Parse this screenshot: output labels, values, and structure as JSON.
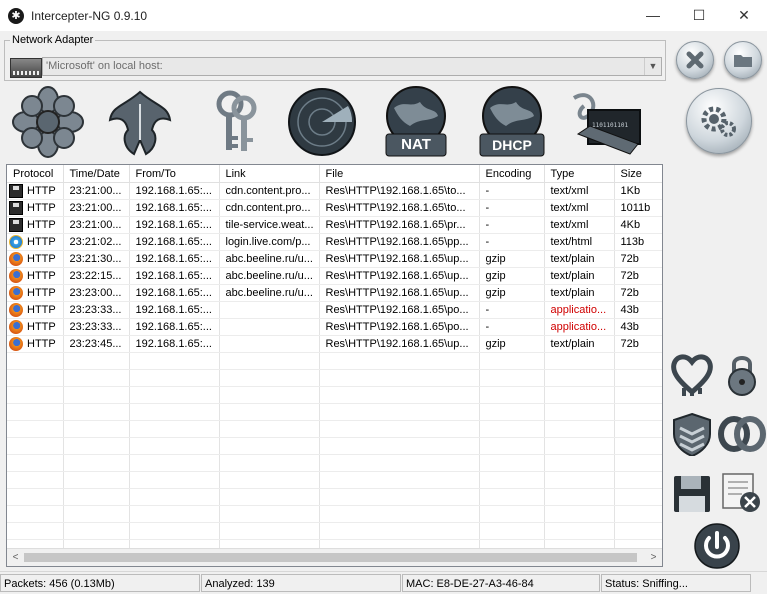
{
  "window": {
    "title": "Intercepter-NG 0.9.10",
    "minimize": "—",
    "maximize": "☐",
    "close": "✕"
  },
  "adapter": {
    "legend": "Network Adapter",
    "selected": "'Microsoft' on local host:"
  },
  "toolbar": [
    {
      "name": "messenger-mode",
      "icon": "flower-icon"
    },
    {
      "name": "phoenix-mode",
      "icon": "phoenix-icon"
    },
    {
      "name": "password-mode",
      "icon": "keys-icon"
    },
    {
      "name": "scan-mode",
      "icon": "radar-icon"
    },
    {
      "name": "nat-mode",
      "icon": "globe-nat-icon",
      "label": "NAT"
    },
    {
      "name": "dhcp-mode",
      "icon": "globe-dhcp-icon",
      "label": "DHCP"
    },
    {
      "name": "raw-mode",
      "icon": "laptop-cable-icon",
      "label": "1101101101"
    }
  ],
  "right_buttons": {
    "stop": "stop-icon",
    "open": "folder-icon",
    "settings": "gears-icon"
  },
  "table": {
    "columns": [
      "Protocol",
      "Time/Date",
      "From/To",
      "Link",
      "File",
      "Encoding",
      "Type",
      "Size"
    ],
    "rows": [
      {
        "icon": "disk",
        "protocol": "HTTP",
        "time": "23:21:00...",
        "from": "192.168.1.65:...",
        "link": "cdn.content.pro...",
        "file": "Res\\HTTP\\192.168.1.65\\to...",
        "encoding": "-",
        "type": "text/xml",
        "size": "1Kb"
      },
      {
        "icon": "disk",
        "protocol": "HTTP",
        "time": "23:21:00...",
        "from": "192.168.1.65:...",
        "link": "cdn.content.pro...",
        "file": "Res\\HTTP\\192.168.1.65\\to...",
        "encoding": "-",
        "type": "text/xml",
        "size": "1011b"
      },
      {
        "icon": "disk",
        "protocol": "HTTP",
        "time": "23:21:00...",
        "from": "192.168.1.65:...",
        "link": "tile-service.weat...",
        "file": "Res\\HTTP\\192.168.1.65\\pr...",
        "encoding": "-",
        "type": "text/xml",
        "size": "4Kb"
      },
      {
        "icon": "ie",
        "protocol": "HTTP",
        "time": "23:21:02...",
        "from": "192.168.1.65:...",
        "link": "login.live.com/p...",
        "file": "Res\\HTTP\\192.168.1.65\\pp...",
        "encoding": "-",
        "type": "text/html",
        "size": "113b"
      },
      {
        "icon": "ff",
        "protocol": "HTTP",
        "time": "23:21:30...",
        "from": "192.168.1.65:...",
        "link": "abc.beeline.ru/u...",
        "file": "Res\\HTTP\\192.168.1.65\\up...",
        "encoding": "gzip",
        "type": "text/plain",
        "size": "72b"
      },
      {
        "icon": "ff",
        "protocol": "HTTP",
        "time": "23:22:15...",
        "from": "192.168.1.65:...",
        "link": "abc.beeline.ru/u...",
        "file": "Res\\HTTP\\192.168.1.65\\up...",
        "encoding": "gzip",
        "type": "text/plain",
        "size": "72b"
      },
      {
        "icon": "ff",
        "protocol": "HTTP",
        "time": "23:23:00...",
        "from": "192.168.1.65:...",
        "link": "abc.beeline.ru/u...",
        "file": "Res\\HTTP\\192.168.1.65\\up...",
        "encoding": "gzip",
        "type": "text/plain",
        "size": "72b"
      },
      {
        "icon": "ff",
        "protocol": "HTTP",
        "time": "23:23:33...",
        "from": "192.168.1.65:...",
        "link": "",
        "file": "Res\\HTTP\\192.168.1.65\\po...",
        "encoding": "-",
        "type": "applicatio...",
        "type_red": true,
        "size": "43b"
      },
      {
        "icon": "ff",
        "protocol": "HTTP",
        "time": "23:23:33...",
        "from": "192.168.1.65:...",
        "link": "",
        "file": "Res\\HTTP\\192.168.1.65\\po...",
        "encoding": "-",
        "type": "applicatio...",
        "type_red": true,
        "size": "43b"
      },
      {
        "icon": "ff",
        "protocol": "HTTP",
        "time": "23:23:45...",
        "from": "192.168.1.65:...",
        "link": "",
        "file": "Res\\HTTP\\192.168.1.65\\up...",
        "encoding": "gzip",
        "type": "text/plain",
        "size": "72b"
      }
    ],
    "empty_rows": 13
  },
  "side_buttons": [
    "heartbleed-icon",
    "padlock-icon",
    "shield-icon",
    "rings-icon",
    "floppy-save-icon",
    "clear-log-icon",
    "power-icon"
  ],
  "status": {
    "packets": "Packets: 456 (0.13Mb)",
    "analyzed": "Analyzed: 139",
    "mac": "MAC: E8-DE-27-A3-46-84",
    "state": "Status: Sniffing..."
  }
}
